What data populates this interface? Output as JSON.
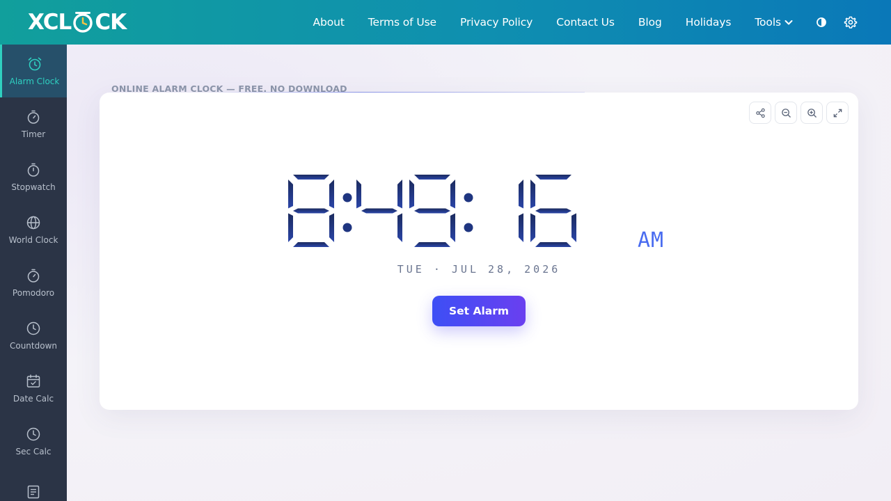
{
  "header": {
    "logo_prefix": "XCL",
    "logo_suffix": "CK",
    "nav": [
      {
        "label": "About"
      },
      {
        "label": "Terms of Use"
      },
      {
        "label": "Privacy Policy"
      },
      {
        "label": "Contact Us"
      },
      {
        "label": "Blog"
      },
      {
        "label": "Holidays"
      },
      {
        "label": "Tools"
      }
    ],
    "icons": [
      "theme-toggle-icon",
      "settings-icon"
    ]
  },
  "sidebar": {
    "items": [
      {
        "label": "Alarm Clock",
        "icon": "alarm-clock-icon",
        "active": true
      },
      {
        "label": "Timer",
        "icon": "timer-icon"
      },
      {
        "label": "Stopwatch",
        "icon": "stopwatch-icon"
      },
      {
        "label": "World Clock",
        "icon": "globe-icon"
      },
      {
        "label": "Pomodoro",
        "icon": "pomodoro-icon"
      },
      {
        "label": "Countdown",
        "icon": "countdown-icon"
      },
      {
        "label": "Date Calc",
        "icon": "calendar-icon"
      },
      {
        "label": "Sec Calc",
        "icon": "clock-icon"
      },
      {
        "label": "",
        "icon": "document-icon"
      }
    ]
  },
  "main": {
    "tagline": "ONLINE ALARM CLOCK — FREE. NO DOWNLOAD",
    "time": "8:49:16",
    "ampm": "AM",
    "date": "TUE · JUL 28, 2026",
    "set_alarm_label": "Set Alarm",
    "tools": [
      "share-icon",
      "zoom-out-icon",
      "zoom-in-icon",
      "fullscreen-icon"
    ]
  },
  "colors": {
    "header_start": "#119f9c",
    "header_end": "#0a78b8",
    "sidebar_bg": "#2b3446",
    "sidebar_active": "#2fd0c0",
    "digit_top": "#1c2b5e",
    "digit_bottom": "#2a45a8",
    "ampm": "#4a6cf0",
    "button_start": "#3d4ff5",
    "button_end": "#6a3ff0"
  }
}
